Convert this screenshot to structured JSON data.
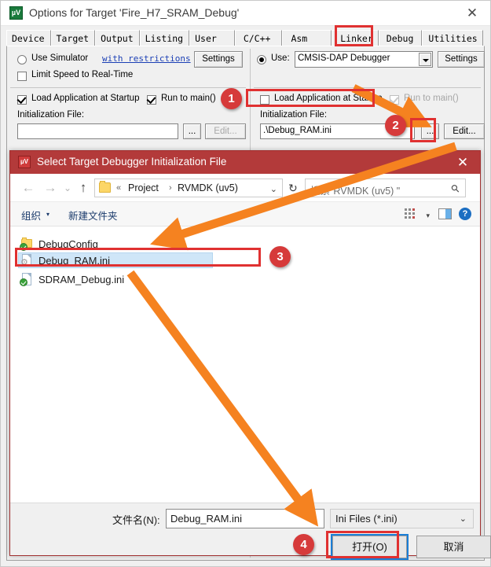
{
  "keil_window": {
    "title": "Options for Target 'Fire_H7_SRAM_Debug'",
    "icon": "keil-uvision-icon",
    "close_label": "✕",
    "tabs": [
      {
        "label": "Device",
        "selected": false
      },
      {
        "label": "Target",
        "selected": false
      },
      {
        "label": "Output",
        "selected": false
      },
      {
        "label": "Listing",
        "selected": false
      },
      {
        "label": "User",
        "selected": false
      },
      {
        "label": "C/C++",
        "selected": false
      },
      {
        "label": "Asm",
        "selected": false
      },
      {
        "label": "Linker",
        "selected": false
      },
      {
        "label": "Debug",
        "selected": true
      },
      {
        "label": "Utilities",
        "selected": false
      }
    ],
    "left_panel": {
      "use_simulator_label": "Use Simulator",
      "with_restrictions_link": "with restrictions",
      "settings_button": "Settings",
      "limit_speed_label": "Limit Speed to Real-Time",
      "load_app_label": "Load Application at Startup",
      "run_to_main_label": "Run to main()",
      "init_file_label": "Initialization File:",
      "init_file_value": "",
      "browse_button": "...",
      "edit_button": "Edit..."
    },
    "right_panel": {
      "use_label": "Use:",
      "debugger_value": "CMSIS-DAP Debugger",
      "settings_button": "Settings",
      "load_app_label": "Load Application at Startup",
      "run_to_main_label": "Run to main()",
      "init_file_label": "Initialization File:",
      "init_file_value": ".\\Debug_RAM.ini",
      "browse_button": "...",
      "edit_button": "Edit..."
    }
  },
  "file_dialog": {
    "title": "Select Target Debugger Initialization File",
    "icon": "keil-uvision-icon",
    "close_label": "✕",
    "nav": {
      "back": "←",
      "forward": "→",
      "history": "⌄",
      "up": "↑",
      "crumb_prefix": "«",
      "crumbs": [
        "Project",
        "RVMDK (uv5)"
      ],
      "crumb_sep": "›",
      "dropdown_caret": "⌄",
      "refresh": "↻",
      "search_placeholder": "搜索\"RVMDK (uv5) \"",
      "search_icon": "search-icon"
    },
    "toolbar": {
      "organize_label": "组织",
      "organize_caret": "▾",
      "new_folder_label": "新建文件夹",
      "view_caret": "▾",
      "help_label": "?"
    },
    "files": [
      {
        "name": "DebugConfig",
        "type": "folder",
        "badge": "check",
        "selected": false
      },
      {
        "name": "Debug_RAM.ini",
        "type": "file",
        "badge": "gear",
        "selected": true
      },
      {
        "name": "SDRAM_Debug.ini",
        "type": "file",
        "badge": "check",
        "selected": false
      }
    ],
    "bottom": {
      "filename_label": "文件名(N):",
      "filename_value": "Debug_RAM.ini",
      "filetype_value": "Ini Files (*.ini)",
      "filetype_caret": "⌄",
      "open_button": "打开(O)",
      "cancel_button": "取消"
    }
  },
  "annotations": {
    "accent_color": "#e03131",
    "arrow_color": "#f58220",
    "badge_color": "#d63a3a",
    "steps": [
      {
        "number": "1",
        "target": "uncheck-load-application-at-startup"
      },
      {
        "number": "2",
        "target": "browse-init-file-button"
      },
      {
        "number": "3",
        "target": "select-debug-ram-ini"
      },
      {
        "number": "4",
        "target": "open-button"
      }
    ]
  }
}
